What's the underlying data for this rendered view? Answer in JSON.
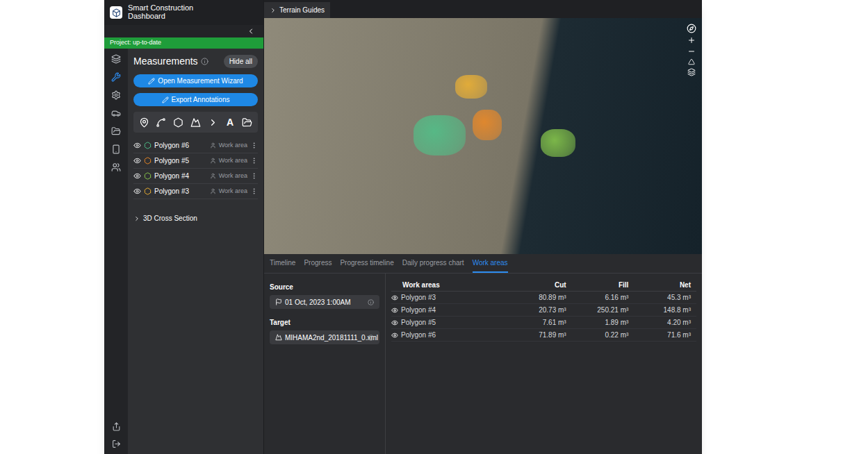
{
  "header": {
    "title_lines": [
      "Smart Construction",
      "Dashboard"
    ]
  },
  "status": {
    "label": "Project: up-to-date"
  },
  "terrain_guides": {
    "label": "Terrain Guides",
    "expanded": false
  },
  "rail": {
    "items": [
      {
        "selected": false
      },
      {
        "selected": true
      },
      {
        "selected": false
      },
      {
        "selected": false
      },
      {
        "selected": false
      },
      {
        "selected": false
      },
      {
        "selected": false
      }
    ]
  },
  "measurements": {
    "title": "Measurements",
    "hide_all": "Hide all",
    "wizard_button": "Open Measurement Wizard",
    "export_button": "Export Annotations",
    "tools": [
      {
        "kind": "pin"
      },
      {
        "kind": "line"
      },
      {
        "kind": "polygon"
      },
      {
        "kind": "volume"
      },
      {
        "kind": "profile"
      },
      {
        "kind": "text",
        "label": "A"
      },
      {
        "kind": "folder"
      }
    ],
    "items": [
      {
        "name": "Polygon #6",
        "tag": "Work area",
        "visible": true,
        "color": "#4fc38a"
      },
      {
        "name": "Polygon #5",
        "tag": "Work area",
        "visible": true,
        "color": "#f08a24"
      },
      {
        "name": "Polygon #4",
        "tag": "Work area",
        "visible": true,
        "color": "#8ccf4d"
      },
      {
        "name": "Polygon #3",
        "tag": "Work area",
        "visible": true,
        "color": "#f2b431"
      }
    ]
  },
  "cross_section": {
    "label": "3D Cross Section",
    "expanded": false
  },
  "bottom": {
    "tabs": [
      {
        "label": "Timeline",
        "selected": false
      },
      {
        "label": "Progress",
        "selected": false
      },
      {
        "label": "Progress timeline",
        "selected": false
      },
      {
        "label": "Daily progress chart",
        "selected": false
      },
      {
        "label": "Work areas",
        "selected": true
      }
    ],
    "source": {
      "label": "Source",
      "value": "01 Oct, 2023 1:00AM"
    },
    "target": {
      "label": "Target",
      "value": "MIHAMA2nd_20181111_0.xml"
    },
    "table": {
      "columns": [
        "Work areas",
        "Cut",
        "Fill",
        "Net"
      ],
      "rows": [
        {
          "name": "Polygon #3",
          "visible": true,
          "cut": "80.89 m³",
          "fill": "6.16 m³",
          "net": "45.3 m³"
        },
        {
          "name": "Polygon #4",
          "visible": true,
          "cut": "20.73 m³",
          "fill": "250.21 m³",
          "net": "148.8 m³"
        },
        {
          "name": "Polygon #5",
          "visible": true,
          "cut": "7.61 m³",
          "fill": "1.89 m³",
          "net": "4.20 m³"
        },
        {
          "name": "Polygon #6",
          "visible": true,
          "cut": "71.89 m³",
          "fill": "0.22 m³",
          "net": "71.6 m³"
        }
      ]
    }
  }
}
